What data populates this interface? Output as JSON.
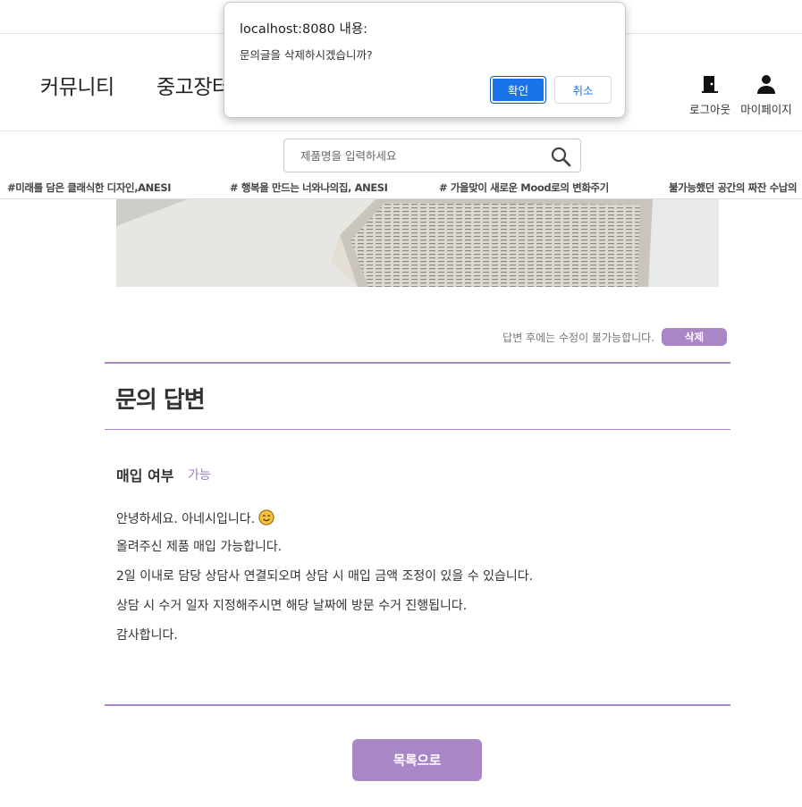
{
  "header": {
    "nav": [
      "커뮤니티",
      "중고장터"
    ],
    "logout_label": "로그아웃",
    "mypage_label": "마이페이지"
  },
  "search": {
    "placeholder": "제품명을 입력하세요"
  },
  "hashtags": [
    "#미래를 담은 클래식한 디자인,ANESI",
    "# 행복을 만드는 너와나의집, ANESI",
    "# 가을맞이 새로운 Mood로의 변화주기",
    "불가능했던 공간의 짜잔 수납의"
  ],
  "answer_section": {
    "edit_notice": "답변 후에는 수정이 불가능합니다.",
    "delete_label": "삭제",
    "title": "문의 답변",
    "purchase_label": "매입 여부",
    "purchase_value": "가능",
    "body_lines": [
      "안녕하세요. 아네시입니다.",
      "올려주신 제품 매입 가능합니다.",
      "2일 이내로 담당 상담사 연결되오며 상담 시 매입 금액 조정이 있을 수 있습니다.",
      "상담 시 수거 일자 지정해주시면 해당 날짜에 방문 수거 진행됩니다.",
      "감사합니다."
    ],
    "list_button_label": "목록으로"
  },
  "dialog": {
    "title": "localhost:8080 내용:",
    "message": "문의글을 삭제하시겠습니까?",
    "ok_label": "확인",
    "cancel_label": "취소"
  },
  "colors": {
    "accent": "#a987c6",
    "dialog_primary": "#1a73e8"
  }
}
